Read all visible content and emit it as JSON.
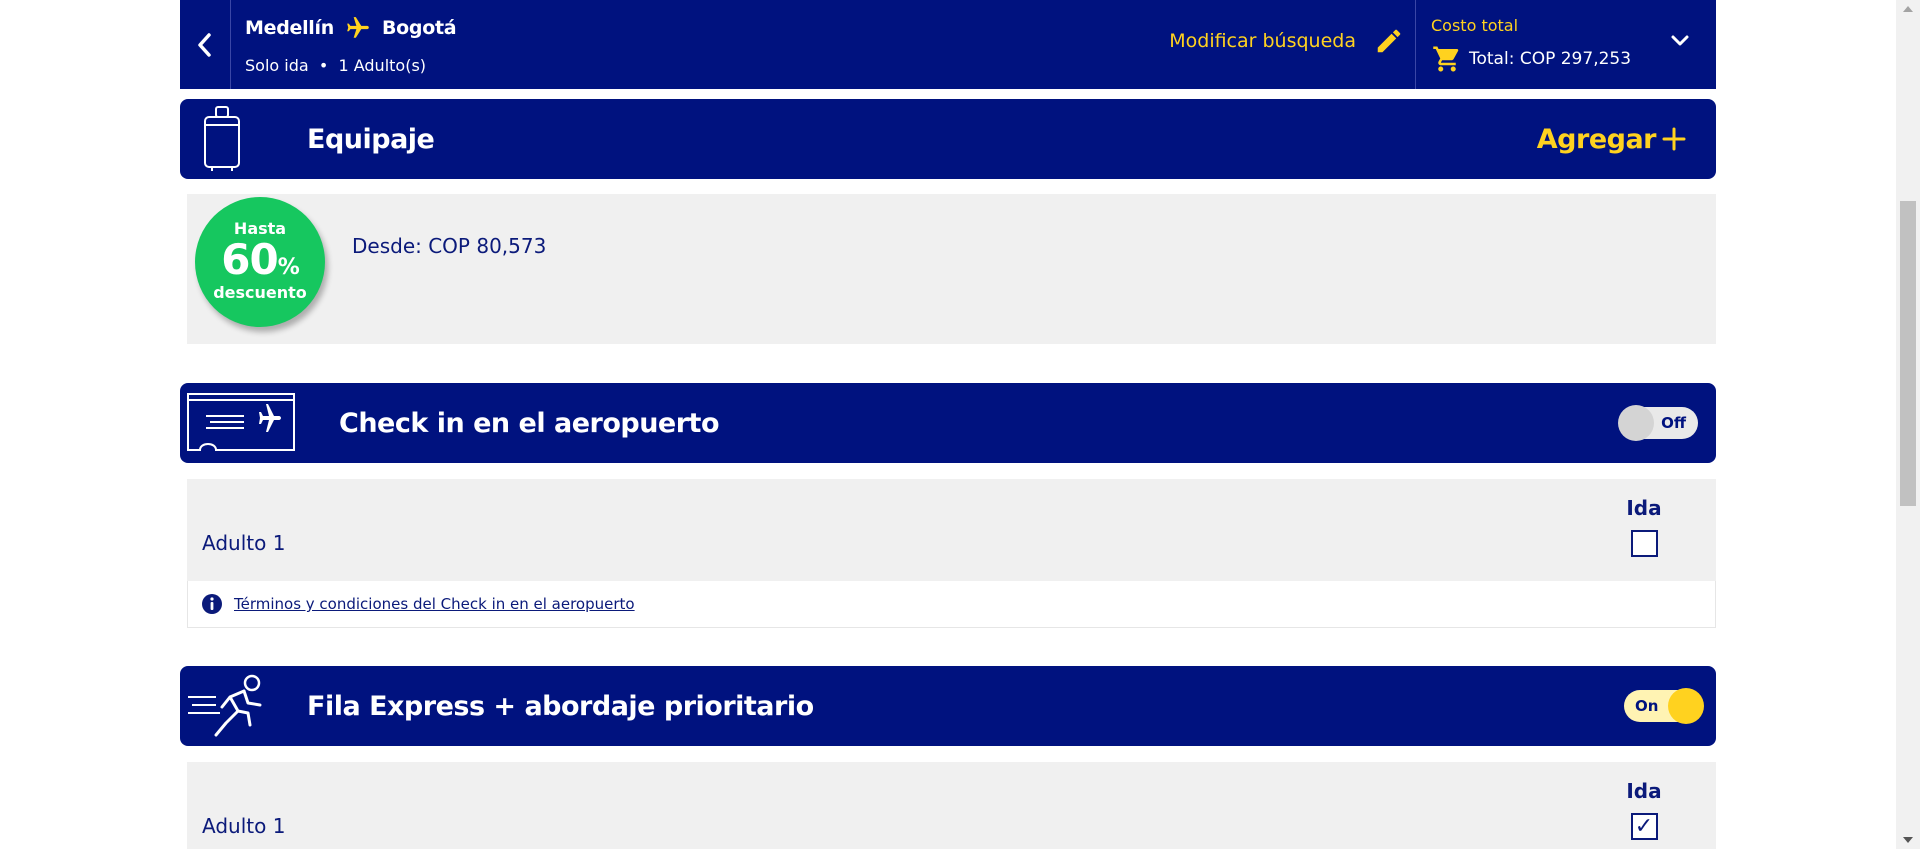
{
  "header": {
    "origin": "Medellín",
    "destination": "Bogotá",
    "trip_type": "Solo ida",
    "passengers": "1 Adulto(s)",
    "modify_label": "Modificar búsqueda",
    "cost_label": "Costo total",
    "total": "Total: COP 297,253"
  },
  "luggage": {
    "title": "Equipaje",
    "add_label": "Agregar",
    "promo": {
      "line1": "Hasta",
      "line2": "60",
      "percent": "%",
      "line3": "descuento"
    },
    "price_from": "Desde: COP 80,573"
  },
  "checkin": {
    "title": "Check in en el aeropuerto",
    "toggle_label": "Off",
    "toggle_on": false,
    "column": "Ida",
    "passenger": "Adulto 1",
    "checked": false,
    "terms_link": "Términos y condiciones del Check in en el aeropuerto"
  },
  "express": {
    "title": "Fila Express + abordaje prioritario",
    "toggle_label": "On",
    "toggle_on": true,
    "column": "Ida",
    "passenger": "Adulto 1",
    "checked": true,
    "check_glyph": "✓"
  },
  "colors": {
    "navy": "#00127f",
    "accent_yellow": "#ffd21f",
    "promo_green": "#16c75f",
    "panel_gray": "#f0f0f0"
  },
  "icons": [
    "chevron-left-icon",
    "airplane-icon",
    "pencil-icon",
    "cart-icon",
    "chevron-down-icon",
    "suitcase-icon",
    "plus-icon",
    "boarding-pass-icon",
    "info-icon",
    "running-person-icon"
  ]
}
